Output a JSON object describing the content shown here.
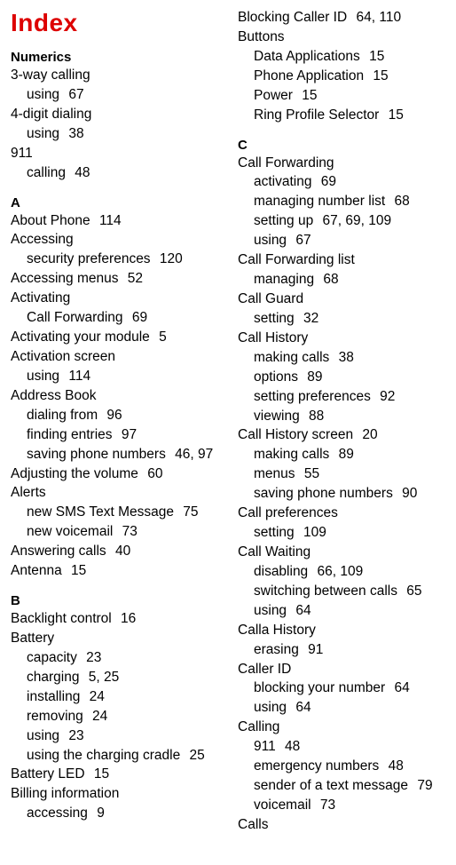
{
  "title": "Index",
  "columns": [
    [
      {
        "type": "head",
        "text": "Numerics"
      },
      {
        "type": "entry",
        "text": "3-way calling"
      },
      {
        "type": "sub",
        "text": "using",
        "pages": " 67"
      },
      {
        "type": "entry",
        "text": "4-digit dialing"
      },
      {
        "type": "sub",
        "text": "using",
        "pages": " 38"
      },
      {
        "type": "entry",
        "text": "911"
      },
      {
        "type": "sub",
        "text": "calling",
        "pages": " 48"
      },
      {
        "type": "head",
        "text": "A"
      },
      {
        "type": "entry",
        "text": "About Phone",
        "pages": " 114"
      },
      {
        "type": "entry",
        "text": "Accessing"
      },
      {
        "type": "sub",
        "text": "security preferences",
        "pages": " 120"
      },
      {
        "type": "entry",
        "text": "Accessing menus",
        "pages": " 52"
      },
      {
        "type": "entry",
        "text": "Activating"
      },
      {
        "type": "sub",
        "text": "Call Forwarding",
        "pages": " 69"
      },
      {
        "type": "entry",
        "text": "Activating your module",
        "pages": " 5"
      },
      {
        "type": "entry",
        "text": "Activation screen"
      },
      {
        "type": "sub",
        "text": "using",
        "pages": " 114"
      },
      {
        "type": "entry",
        "text": "Address Book"
      },
      {
        "type": "sub",
        "text": "dialing from",
        "pages": " 96"
      },
      {
        "type": "sub",
        "text": "finding entries",
        "pages": " 97"
      },
      {
        "type": "sub",
        "text": "saving phone numbers",
        "pages": " 46,  97"
      },
      {
        "type": "entry",
        "text": "Adjusting the volume",
        "pages": " 60"
      },
      {
        "type": "entry",
        "text": "Alerts"
      },
      {
        "type": "sub",
        "text": "new SMS Text Message",
        "pages": " 75"
      },
      {
        "type": "sub",
        "text": "new voicemail",
        "pages": " 73"
      },
      {
        "type": "entry",
        "text": "Answering calls",
        "pages": " 40"
      },
      {
        "type": "entry",
        "text": "Antenna",
        "pages": " 15"
      },
      {
        "type": "head",
        "text": "B"
      },
      {
        "type": "entry",
        "text": "Backlight control",
        "pages": " 16"
      },
      {
        "type": "entry",
        "text": "Battery"
      },
      {
        "type": "sub",
        "text": "capacity",
        "pages": " 23"
      },
      {
        "type": "sub",
        "text": "charging",
        "pages": " 5,  25"
      },
      {
        "type": "sub",
        "text": "installing",
        "pages": " 24"
      },
      {
        "type": "sub",
        "text": "removing",
        "pages": " 24"
      },
      {
        "type": "sub",
        "text": "using",
        "pages": " 23"
      },
      {
        "type": "sub",
        "text": "using the charging cradle",
        "pages": " 25"
      },
      {
        "type": "entry",
        "text": "Battery LED",
        "pages": " 15"
      },
      {
        "type": "entry",
        "text": "Billing information"
      },
      {
        "type": "sub",
        "text": "accessing",
        "pages": " 9"
      }
    ],
    [
      {
        "type": "entry",
        "text": "Blocking Caller ID",
        "pages": " 64,  110"
      },
      {
        "type": "entry",
        "text": "Buttons"
      },
      {
        "type": "sub",
        "text": "Data Applications",
        "pages": " 15"
      },
      {
        "type": "sub",
        "text": "Phone Application",
        "pages": " 15"
      },
      {
        "type": "sub",
        "text": "Power",
        "pages": " 15"
      },
      {
        "type": "sub",
        "text": "Ring Profile Selector",
        "pages": " 15"
      },
      {
        "type": "head",
        "text": "C"
      },
      {
        "type": "entry",
        "text": "Call Forwarding"
      },
      {
        "type": "sub",
        "text": "activating",
        "pages": " 69"
      },
      {
        "type": "sub",
        "text": "managing number list",
        "pages": " 68"
      },
      {
        "type": "sub",
        "text": "setting up",
        "pages": " 67,  69,  109"
      },
      {
        "type": "sub",
        "text": "using",
        "pages": " 67"
      },
      {
        "type": "entry",
        "text": "Call Forwarding list"
      },
      {
        "type": "sub",
        "text": "managing",
        "pages": " 68"
      },
      {
        "type": "entry",
        "text": "Call Guard"
      },
      {
        "type": "sub",
        "text": "setting",
        "pages": " 32"
      },
      {
        "type": "entry",
        "text": "Call History"
      },
      {
        "type": "sub",
        "text": "making calls",
        "pages": " 38"
      },
      {
        "type": "sub",
        "text": "options",
        "pages": " 89"
      },
      {
        "type": "sub",
        "text": "setting preferences",
        "pages": " 92"
      },
      {
        "type": "sub",
        "text": "viewing",
        "pages": " 88"
      },
      {
        "type": "entry",
        "text": "Call History screen",
        "pages": " 20"
      },
      {
        "type": "sub",
        "text": "making calls",
        "pages": " 89"
      },
      {
        "type": "sub",
        "text": "menus",
        "pages": " 55"
      },
      {
        "type": "sub",
        "text": "saving phone numbers",
        "pages": " 90"
      },
      {
        "type": "entry",
        "text": "Call preferences"
      },
      {
        "type": "sub",
        "text": "setting",
        "pages": " 109"
      },
      {
        "type": "entry",
        "text": "Call Waiting"
      },
      {
        "type": "sub",
        "text": "disabling",
        "pages": " 66,  109"
      },
      {
        "type": "sub",
        "text": "switching between calls",
        "pages": " 65"
      },
      {
        "type": "sub",
        "text": "using",
        "pages": " 64"
      },
      {
        "type": "entry",
        "text": "Calla History"
      },
      {
        "type": "sub",
        "text": "erasing",
        "pages": " 91"
      },
      {
        "type": "entry",
        "text": "Caller ID"
      },
      {
        "type": "sub",
        "text": "blocking your number",
        "pages": " 64"
      },
      {
        "type": "sub",
        "text": "using",
        "pages": " 64"
      },
      {
        "type": "entry",
        "text": "Calling"
      },
      {
        "type": "sub",
        "text": "911",
        "pages": " 48"
      },
      {
        "type": "sub",
        "text": "emergency numbers",
        "pages": " 48"
      },
      {
        "type": "sub",
        "text": "sender of a text message",
        "pages": " 79"
      },
      {
        "type": "sub",
        "text": "voicemail",
        "pages": " 73"
      },
      {
        "type": "entry",
        "text": "Calls"
      }
    ]
  ]
}
